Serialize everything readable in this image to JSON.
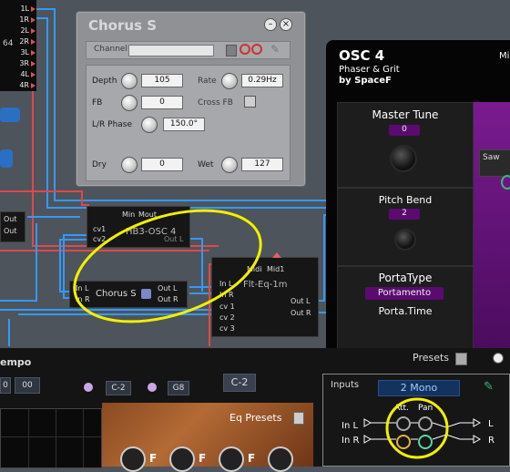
{
  "colors": {
    "wire_blue": "#3399ff",
    "wire_red": "#e04848",
    "highlight": "#f0f000",
    "osc_purple": "#6b0f82"
  },
  "ports": [
    "1L",
    "1R",
    "2L",
    "2R",
    "3L",
    "3R",
    "4L",
    "4R"
  ],
  "port_strip_side_label": "64",
  "left_stubs": [
    "Out",
    "Out"
  ],
  "chorus": {
    "title": "Chorus S",
    "channel_label": "Channel",
    "depth_label": "Depth",
    "depth_value": "105",
    "rate_label": "Rate",
    "rate_value": "0.29Hz",
    "fb_label": "FB",
    "fb_value": "0",
    "crossfb_label": "Cross FB",
    "lrphase_label": "L/R Phase",
    "lrphase_value": "150.0°",
    "dry_label": "Dry",
    "dry_value": "0",
    "wet_label": "Wet",
    "wet_value": "127"
  },
  "modules": {
    "osc4": {
      "label": "HB3-OSC 4",
      "top_left": "Min",
      "top_right": "Mout",
      "cv1": "cv1",
      "cv2": "cv2",
      "out": "Out L"
    },
    "chorus": {
      "label": "Chorus S",
      "in_l": "In L",
      "in_r": "In R",
      "out_l": "Out L",
      "out_r": "Out R"
    },
    "flteq": {
      "label": "Flt-Eq-1m",
      "midi": "Midi",
      "midi1": "Mid1",
      "in_l": "In L",
      "in_r": "In R",
      "cv1": "cv 1",
      "cv2": "cv 2",
      "cv3": "cv 3",
      "out_l": "Out L",
      "out_r": "Out R"
    }
  },
  "osc": {
    "title": "OSC 4",
    "subtitle": "Phaser & Grit",
    "author": "by SpaceF",
    "corner": "Mi",
    "master_tune_label": "Master Tune",
    "master_tune_value": "0",
    "pitch_bend_label": "Pitch Bend",
    "pitch_bend_value": "2",
    "porta_type_label": "PortaType",
    "porta_type_value": "Portamento",
    "porta_time_label": "Porta.Time",
    "saw_label": "Saw"
  },
  "bottom": {
    "tempo_label": "empo",
    "tempo_v1": "0",
    "tempo_v2": "00",
    "note_low": "C-2",
    "note_high": "G8",
    "note_display": "C-2",
    "presets_label": "Presets",
    "eq_presets_label": "Eq Presets",
    "f_labels": [
      "F",
      "F",
      "F"
    ]
  },
  "inputs": {
    "title": "Inputs",
    "mode": "2 Mono",
    "att": "Att.",
    "pan": "Pan",
    "in_l": "In L",
    "in_r": "In R",
    "out_l": "L",
    "out_r": "R"
  }
}
